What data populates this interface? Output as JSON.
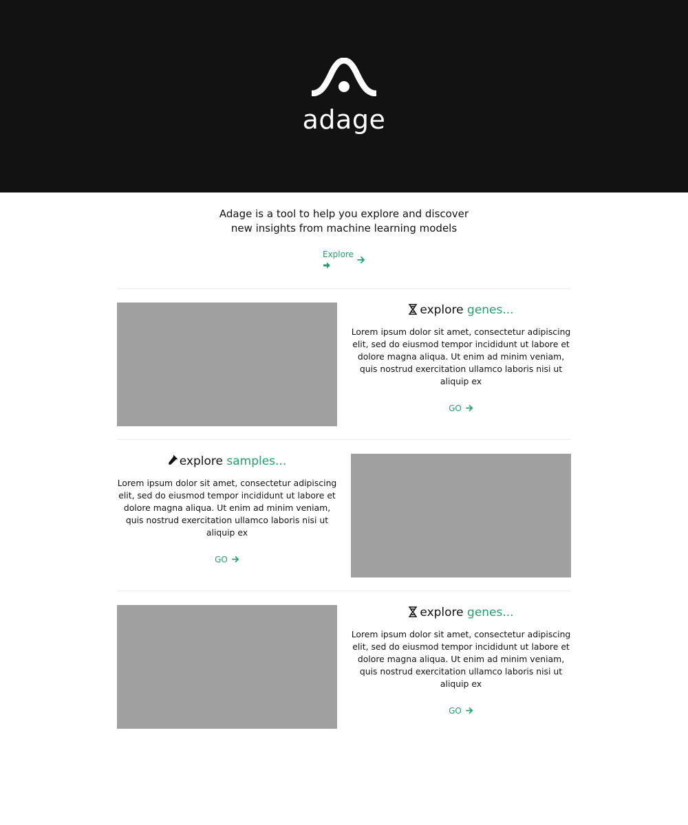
{
  "brand": {
    "name": "adage",
    "logo_icon": "adage-arc-dot-logo"
  },
  "intro": {
    "line1": "Adage is a tool to help you explore and discover",
    "line2": "new insights from machine learning models",
    "explore_label": "Explore"
  },
  "sections": [
    {
      "icon": "dna-icon",
      "title_prefix": "explore",
      "title_highlight": "genes...",
      "body": "Lorem ipsum dolor sit amet, consectetur adipiscing elit, sed do eiusmod tempor incididunt ut labore et dolore magna aliqua. Ut enim ad minim veniam, quis nostrud exercitation ullamco laboris nisi ut aliquip ex",
      "go_label": "GO"
    },
    {
      "icon": "test-tube-icon",
      "title_prefix": "explore",
      "title_highlight": "samples...",
      "body": "Lorem ipsum dolor sit amet, consectetur adipiscing elit, sed do eiusmod tempor incididunt ut labore et dolore magna aliqua. Ut enim ad minim veniam, quis nostrud exercitation ullamco laboris nisi ut aliquip ex",
      "go_label": "GO"
    },
    {
      "icon": "dna-icon",
      "title_prefix": "explore",
      "title_highlight": "genes...",
      "body": "Lorem ipsum dolor sit amet, consectetur adipiscing elit, sed do eiusmod tempor incididunt ut labore et dolore magna aliqua. Ut enim ad minim veniam, quis nostrud exercitation ullamco laboris nisi ut aliquip ex",
      "go_label": "GO"
    }
  ],
  "colors": {
    "header_bg": "#121212",
    "accent": "#22a06b",
    "placeholder": "#a0a0a0"
  }
}
